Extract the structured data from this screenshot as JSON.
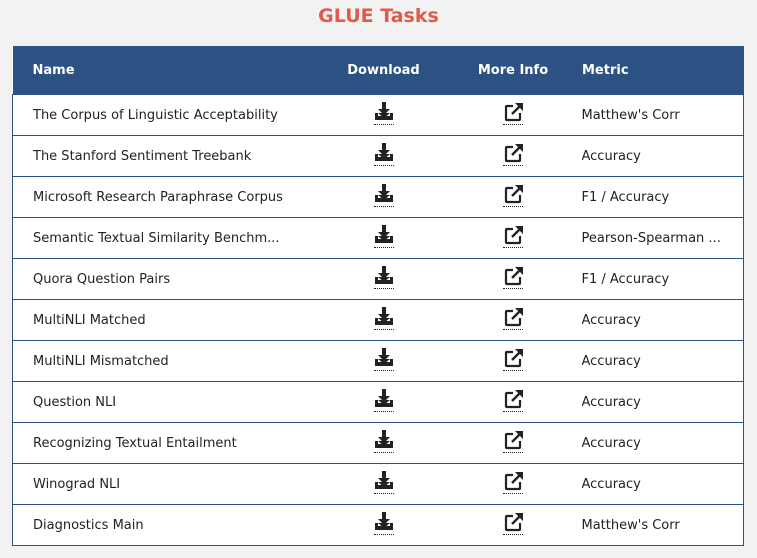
{
  "title": "GLUE Tasks",
  "columns": {
    "name": "Name",
    "download": "Download",
    "info": "More Info",
    "metric": "Metric"
  },
  "rows": [
    {
      "name": "The Corpus of Linguistic Acceptability",
      "metric": "Matthew's Corr"
    },
    {
      "name": "The Stanford Sentiment Treebank",
      "metric": "Accuracy"
    },
    {
      "name": "Microsoft Research Paraphrase Corpus",
      "metric": "F1 / Accuracy"
    },
    {
      "name": "Semantic Textual Similarity Benchm...",
      "metric": "Pearson-Spearman ..."
    },
    {
      "name": "Quora Question Pairs",
      "metric": "F1 / Accuracy"
    },
    {
      "name": "MultiNLI Matched",
      "metric": "Accuracy"
    },
    {
      "name": "MultiNLI Mismatched",
      "metric": "Accuracy"
    },
    {
      "name": "Question NLI",
      "metric": "Accuracy"
    },
    {
      "name": "Recognizing Textual Entailment",
      "metric": "Accuracy"
    },
    {
      "name": "Winograd NLI",
      "metric": "Accuracy"
    },
    {
      "name": "Diagnostics Main",
      "metric": "Matthew's Corr"
    }
  ],
  "icons": {
    "download": "download-icon",
    "info": "external-link-icon"
  },
  "colors": {
    "title": "#e05a4e",
    "header_bg": "#2b5283",
    "header_text": "#ffffff"
  }
}
